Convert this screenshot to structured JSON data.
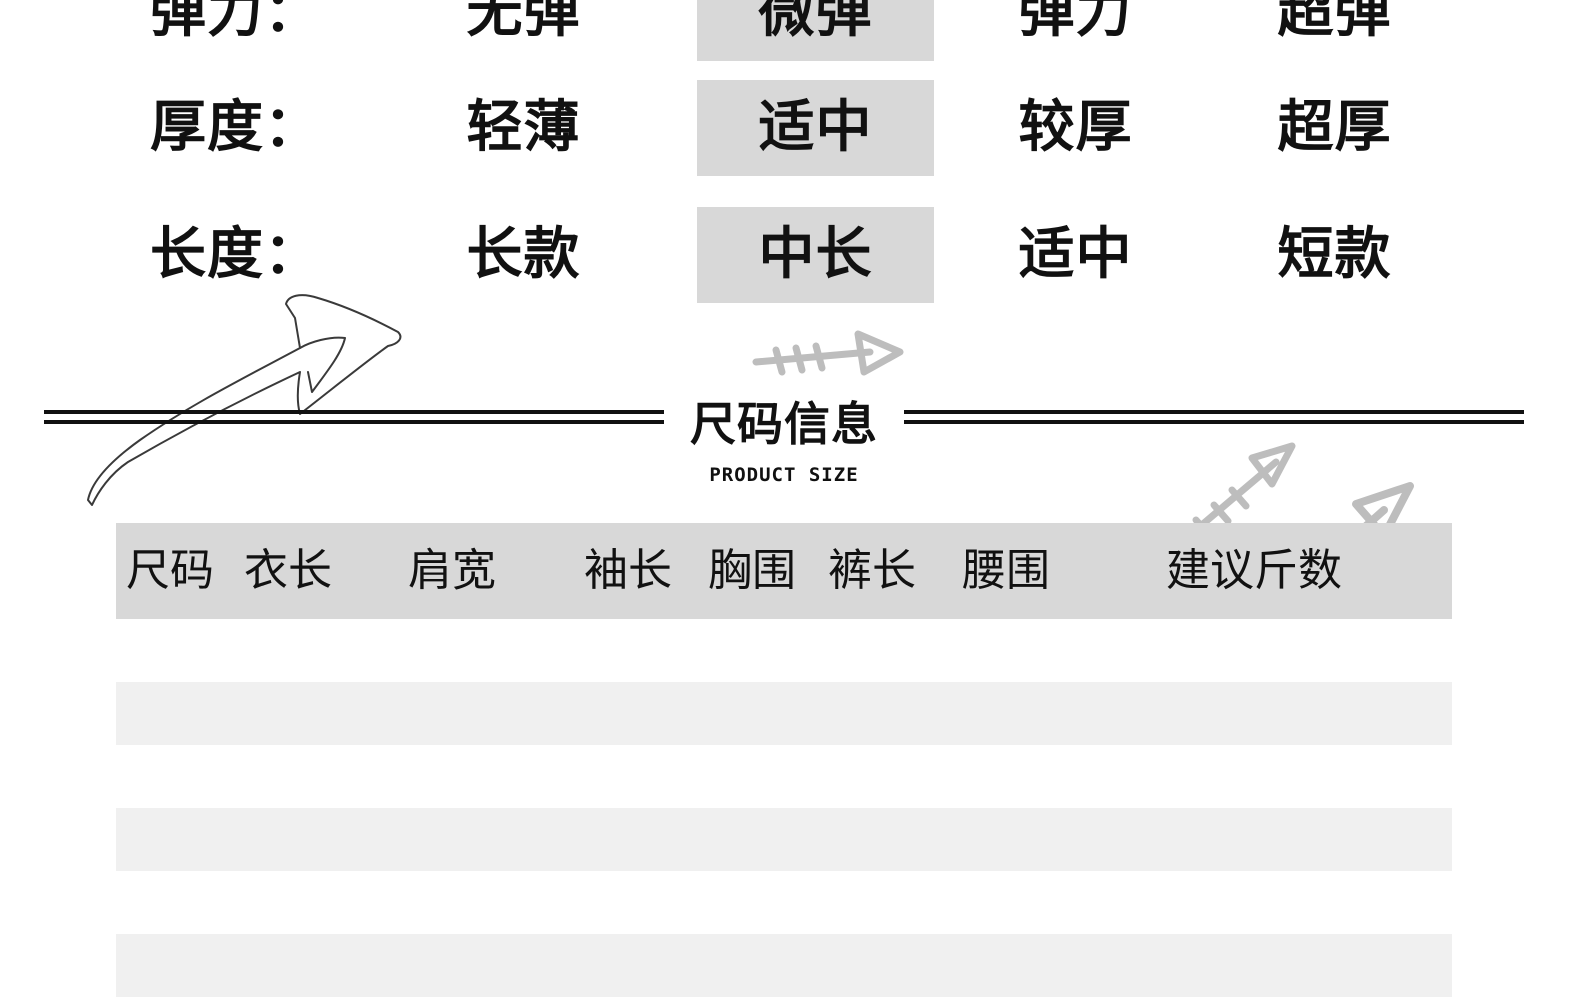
{
  "attributes": [
    {
      "label": "弹力：",
      "options": [
        "无弹",
        "微弹",
        "弹力",
        "超弹"
      ],
      "selected": 1
    },
    {
      "label": "厚度：",
      "options": [
        "轻薄",
        "适中",
        "较厚",
        "超厚"
      ],
      "selected": 1
    },
    {
      "label": "长度：",
      "options": [
        "长款",
        "中长",
        "适中",
        "短款"
      ],
      "selected": 1
    }
  ],
  "section": {
    "title": "尺码信息",
    "subtitle": "PRODUCT SIZE"
  },
  "size_table": {
    "headers": [
      "尺码",
      "衣长",
      "肩宽",
      "袖长",
      "胸围",
      "裤长",
      "腰围",
      "建议斤数"
    ],
    "rows": [
      [],
      [],
      [],
      [],
      [],
      []
    ]
  },
  "colors": {
    "selected_background": "#d8d8d8",
    "row_shade": "#f0f0f0",
    "text": "#111111",
    "arrow_decoration": "#bdbdbd"
  }
}
